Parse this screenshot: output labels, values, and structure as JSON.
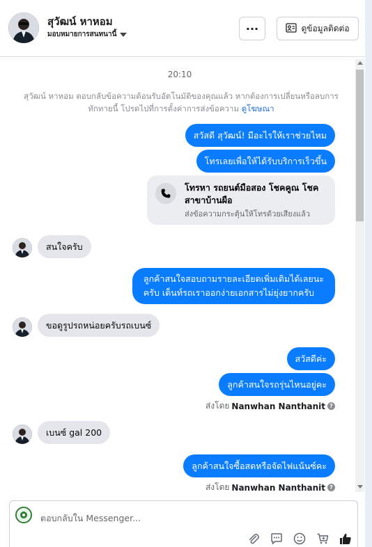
{
  "header": {
    "contact_name": "สุวัฒน์ หาหอม",
    "assign_label": "มอบหมายการสนทนานี้",
    "more_label": "···",
    "contact_info_label": "ดูข้อมูลติดต่อ"
  },
  "conversation": {
    "time": "20:10",
    "notice_text": "สุวัฒน์ หาหอม ตอบกลับข้อความต้อนรับอัตโนมัติของคุณแล้ว หากต้องการเปลี่ยนหรือลบการทักทายนี้ โปรดไปที่การตั้งค่าการส่งข้อความ",
    "notice_link": "ดูโฆษณา",
    "msg_1": "สวัสดี สุวัฒน์! มีอะไรให้เราช่วยไหม",
    "msg_2": "โทรเลยเพื่อให้ได้รับบริการเร็วขึ้น",
    "call_card": {
      "title": "โทรหา รถยนต์มือสอง โชคคูณ โชค สาขาบ้านผือ",
      "subtitle": "ส่งข้อความกระตุ้นให้โทรด้วยเสียงแล้ว"
    },
    "msg_3": "สนใจครับ",
    "msg_4_line1": "ลูกค้าสนใจสอบถามรายละเอียดเพิ่มเติมได้เลยนะ",
    "msg_4_line2": "ครับ เต็นท์รถเราออกง่ายเอกสารไม่ยุ่งยากครับ",
    "msg_5": "ขอดูรูปรถหน่อยครับรถเบนซ์",
    "msg_6": "สวัสดีค่ะ",
    "msg_7": "ลูกค้าสนใจรถรุ่นไหนอยู่คะ",
    "sent_by_prefix": "ส่งโดย",
    "sent_by_name": "Nanwhan Nanthanit",
    "msg_8": "เบนซ์ gal 200",
    "msg_9": "ลูกค้าสนใจซื้อสดหรือจัดไฟแน้นซ์คะ"
  },
  "composer": {
    "placeholder": "ตอบกลับใน Messenger..."
  },
  "icons": [
    "chevron-down-icon",
    "more-icon",
    "contact-card-icon",
    "phone-icon",
    "info-icon",
    "attach-icon",
    "saved-reply-icon",
    "emoji-icon",
    "cart-icon",
    "like-icon"
  ],
  "colors": {
    "outgoing_bubble": "#0a7cff",
    "incoming_bubble": "#e4e6eb",
    "link": "#216fdb"
  }
}
